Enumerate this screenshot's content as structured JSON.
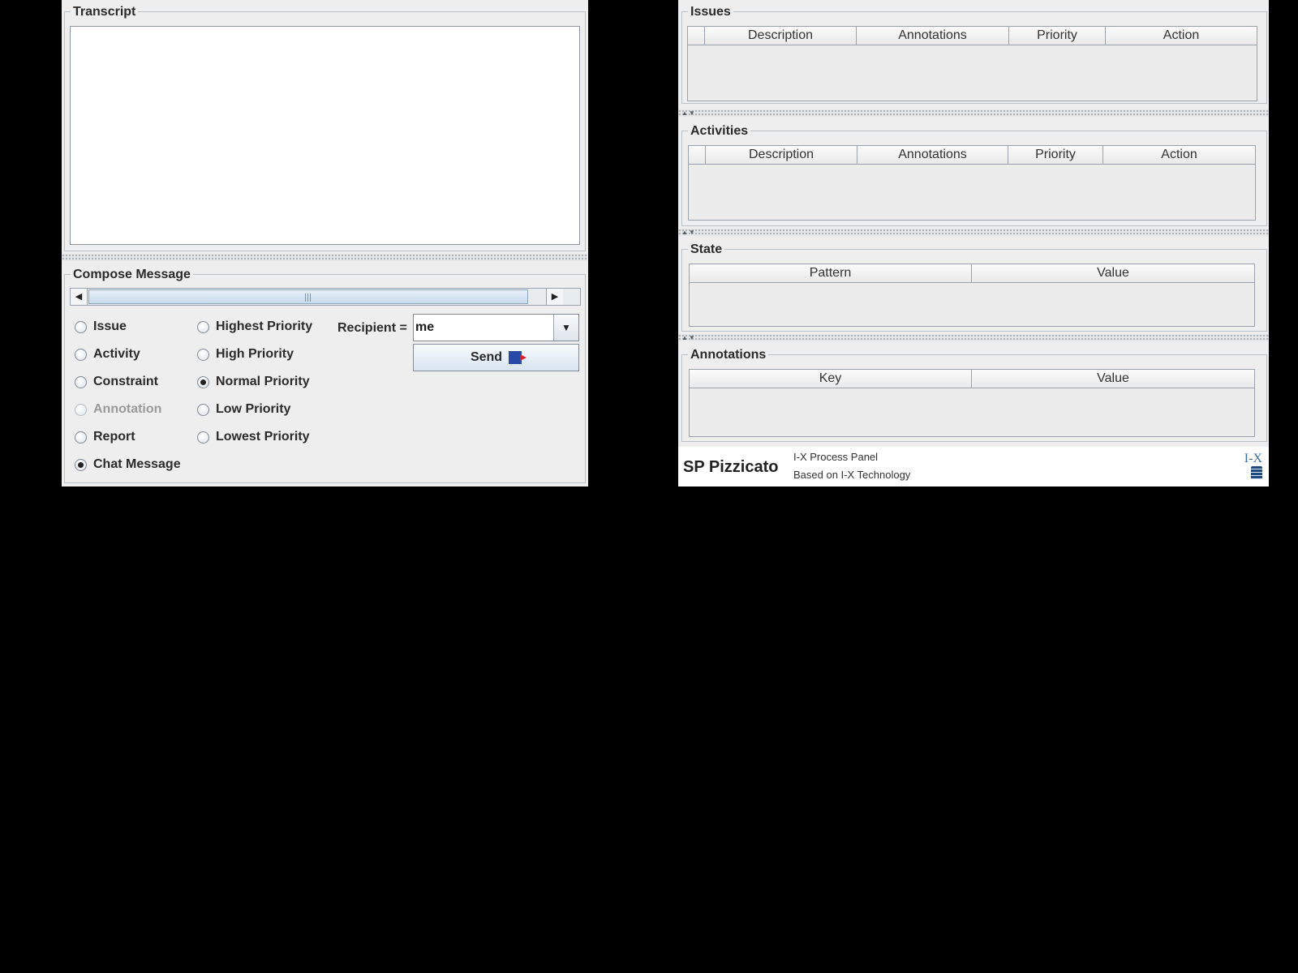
{
  "left_panel": {
    "transcript": {
      "title": "Transcript"
    },
    "compose": {
      "title": "Compose Message",
      "types": [
        {
          "label": "Issue",
          "selected": false,
          "enabled": true
        },
        {
          "label": "Activity",
          "selected": false,
          "enabled": true
        },
        {
          "label": "Constraint",
          "selected": false,
          "enabled": true
        },
        {
          "label": "Annotation",
          "selected": false,
          "enabled": false
        },
        {
          "label": "Report",
          "selected": false,
          "enabled": true
        },
        {
          "label": "Chat Message",
          "selected": true,
          "enabled": true
        }
      ],
      "priorities": [
        {
          "label": "Highest Priority",
          "selected": false
        },
        {
          "label": "High Priority",
          "selected": false
        },
        {
          "label": "Normal Priority",
          "selected": true
        },
        {
          "label": "Low Priority",
          "selected": false
        },
        {
          "label": "Lowest Priority",
          "selected": false
        }
      ],
      "recipient_label": "Recipient =",
      "recipient_value": "me",
      "send_label": "Send"
    }
  },
  "right_panel": {
    "issues": {
      "title": "Issues",
      "columns": [
        "",
        "Description",
        "Annotations",
        "Priority",
        "Action"
      ]
    },
    "activities": {
      "title": "Activities",
      "columns": [
        "",
        "Description",
        "Annotations",
        "Priority",
        "Action"
      ]
    },
    "state": {
      "title": "State",
      "columns": [
        "Pattern",
        "Value"
      ]
    },
    "annotations": {
      "title": "Annotations",
      "columns": [
        "Key",
        "Value"
      ]
    },
    "footer": {
      "brand": "SP Pizzicato",
      "line1": "I-X Process Panel",
      "line2": "Based on I-X Technology",
      "logo_text": "I-X"
    }
  },
  "icons": {
    "scroll_left": "left-triangle",
    "scroll_right": "right-triangle",
    "combo": "chevron-down",
    "send": "send-message-icon",
    "document": "document-icon"
  }
}
